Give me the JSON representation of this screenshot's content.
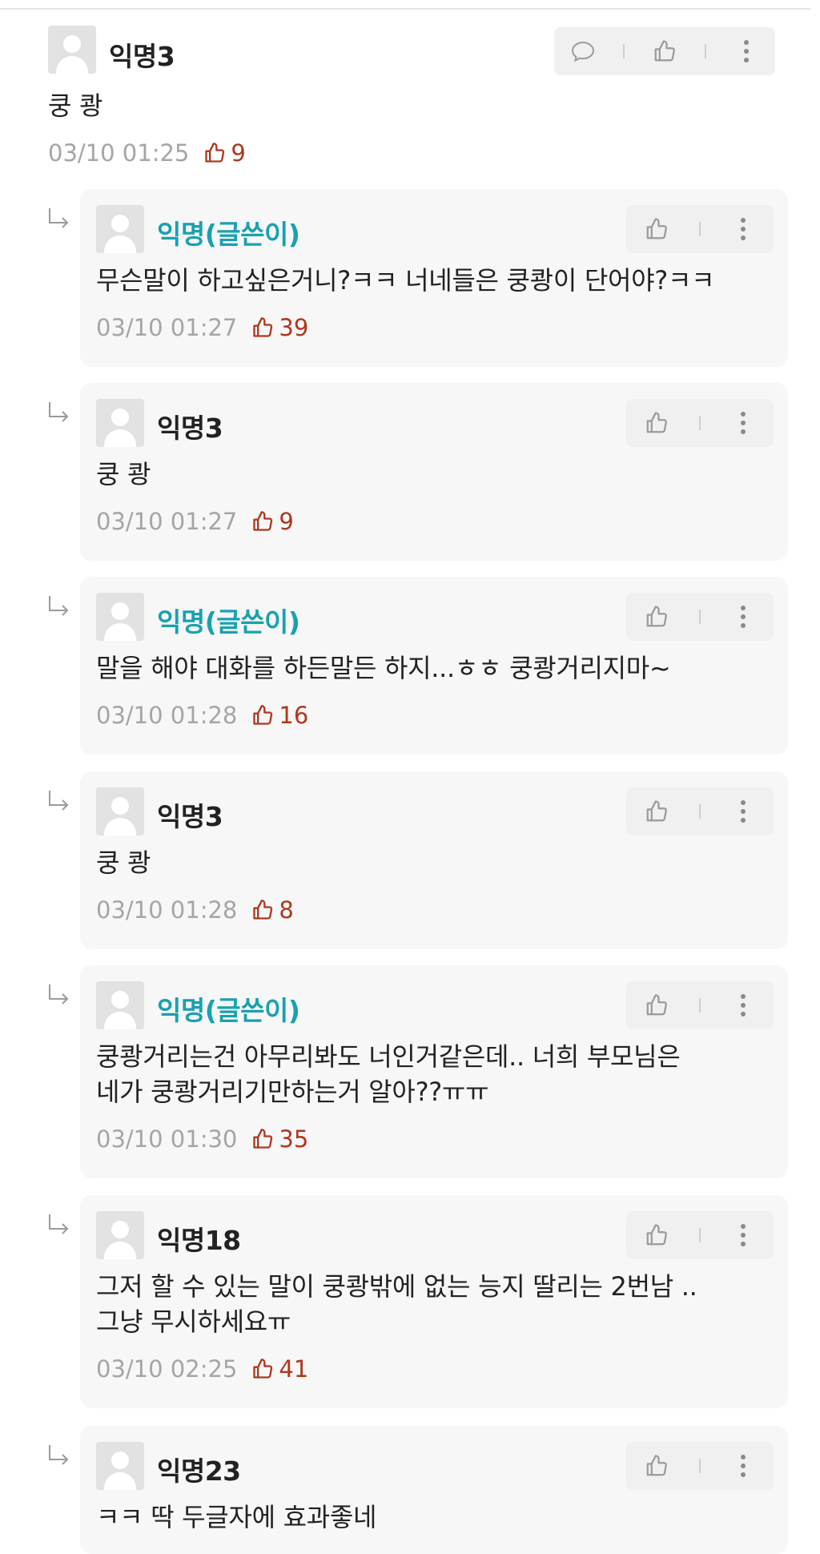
{
  "comments": [
    {
      "name": "익명3",
      "text": "쿵 쾅",
      "time": "03/10 01:25",
      "likes": "9"
    }
  ],
  "replies": [
    {
      "name": "익명(글쓴이)",
      "author": true,
      "lines": [
        "무슨말이 하고싶은거니?ㅋㅋ 너네들은 쿵쾅이 단어야?ㅋㅋ"
      ],
      "time": "03/10 01:27",
      "likes": "39"
    },
    {
      "name": "익명3",
      "author": false,
      "lines": [
        "쿵 쾅"
      ],
      "time": "03/10 01:27",
      "likes": "9"
    },
    {
      "name": "익명(글쓴이)",
      "author": true,
      "lines": [
        "말을 해야 대화를 하든말든 하지...ㅎㅎ 쿵쾅거리지마~"
      ],
      "time": "03/10 01:28",
      "likes": "16"
    },
    {
      "name": "익명3",
      "author": false,
      "lines": [
        "쿵 쾅"
      ],
      "time": "03/10 01:28",
      "likes": "8"
    },
    {
      "name": "익명(글쓴이)",
      "author": true,
      "lines": [
        "쿵쾅거리는건 아무리봐도 너인거같은데.. 너희 부모님은",
        "네가 쿵쾅거리기만하는거 알아??ㅠㅠ"
      ],
      "time": "03/10 01:30",
      "likes": "35"
    },
    {
      "name": "익명18",
      "author": false,
      "lines": [
        "그저 할 수 있는 말이 쿵쾅밖에 없는 능지 딸리는 2번남 ..",
        "그냥 무시하세요ㅠ"
      ],
      "time": "03/10 02:25",
      "likes": "41"
    },
    {
      "name": "익명23",
      "author": false,
      "lines": [
        "ㅋㅋ 딱 두글자에 효과좋네"
      ],
      "time": "",
      "likes": ""
    }
  ],
  "colors": {
    "author": "#19a1b0",
    "likes": "#b0361d",
    "meta": "#a5a5a5"
  },
  "icons": {
    "comment": "speech-bubble-icon",
    "like": "thumbs-up-icon",
    "more": "vertical-ellipsis-icon",
    "reply": "reply-arrow-icon"
  }
}
